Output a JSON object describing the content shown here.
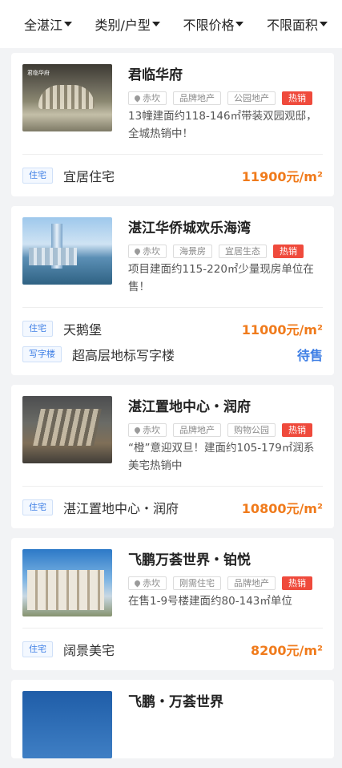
{
  "filters": [
    {
      "label": "全湛江"
    },
    {
      "label": "类别/户型"
    },
    {
      "label": "不限价格"
    },
    {
      "label": "不限面积"
    }
  ],
  "cards": [
    {
      "title": "君临华府",
      "thumb_text": "君临华府",
      "location": "赤坎",
      "tags": [
        "品牌地产",
        "公园地产"
      ],
      "hot": "热销",
      "desc": "13幢建面约118-146㎡带装双园观邸，全城热销中！",
      "rows": [
        {
          "type": "住宅",
          "name": "宜居住宅",
          "price": "11900元/m²"
        }
      ]
    },
    {
      "title": "湛江华侨城欢乐海湾",
      "location": "赤坎",
      "tags": [
        "海景房",
        "宜居生态"
      ],
      "hot": "热销",
      "desc": "项目建面约115-220㎡少量现房单位在售！",
      "rows": [
        {
          "type": "住宅",
          "name": "天鹅堡",
          "price": "11000元/m²"
        },
        {
          "type": "写字楼",
          "name": "超高层地标写字楼",
          "status": "待售"
        }
      ]
    },
    {
      "title": "湛江置地中心・润府",
      "location": "赤坎",
      "tags": [
        "品牌地产",
        "购物公园"
      ],
      "hot": "热销",
      "desc": "“橙”意迎双旦！建面约105-179㎡润系美宅热销中",
      "rows": [
        {
          "type": "住宅",
          "name": "湛江置地中心・润府",
          "price": "10800元/m²"
        }
      ]
    },
    {
      "title": "飞鹏万荟世界・铂悦",
      "location": "赤坎",
      "tags": [
        "刚需住宅",
        "品牌地产"
      ],
      "hot": "热销",
      "desc": "在售1-9号楼建面约80-143㎡单位",
      "rows": [
        {
          "type": "住宅",
          "name": "阔景美宅",
          "price": "8200元/m²"
        }
      ]
    },
    {
      "title": "飞鹏・万荟世界"
    }
  ]
}
